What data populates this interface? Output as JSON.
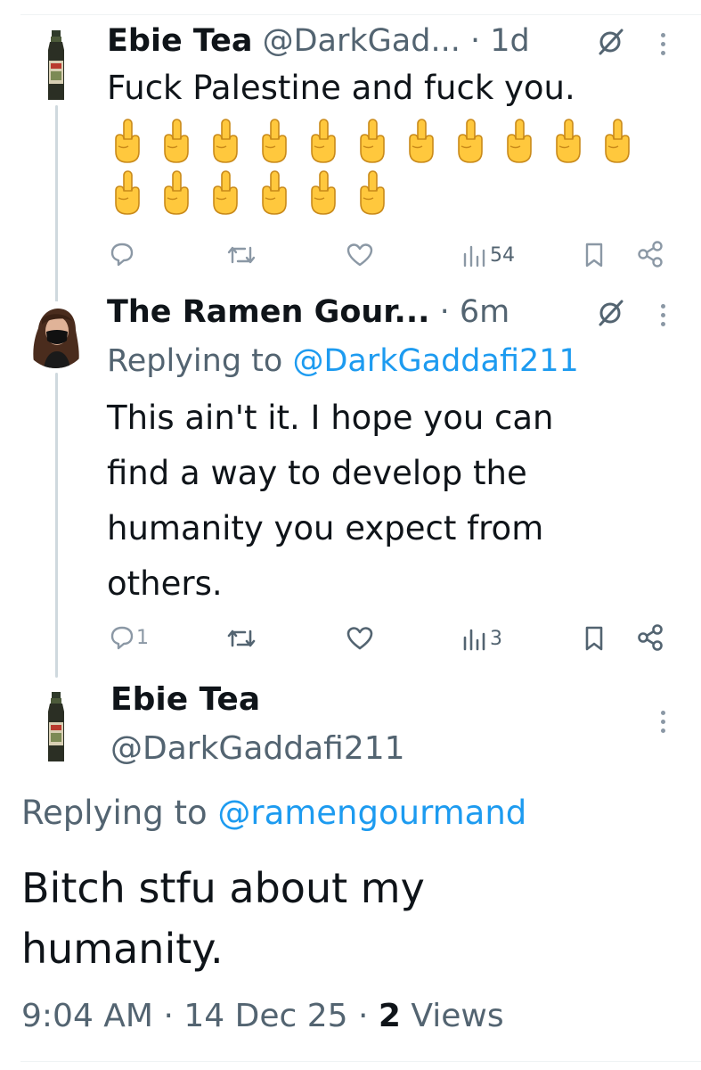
{
  "tweet1": {
    "name": "Ebie Tea",
    "handle": "@DarkGad...",
    "dot": "·",
    "time": "1d",
    "text": "Fuck Palestine and fuck you.",
    "emoji": "🖕",
    "emoji_count": 17,
    "actions": {
      "replies": "",
      "reposts": "",
      "likes": "",
      "views": "54"
    }
  },
  "tweet2": {
    "name": "The Ramen Gour...",
    "dot": "·",
    "time": "6m",
    "replying_prefix": "Replying to ",
    "replying_to": "@DarkGaddafi211",
    "text_lines": [
      "This ain't it. I hope you can",
      "find a way to develop the",
      "humanity you expect from",
      "others."
    ],
    "actions": {
      "replies": "1",
      "reposts": "",
      "likes": "",
      "views": "3"
    }
  },
  "main": {
    "name": "Ebie Tea",
    "handle": "@DarkGaddafi211",
    "replying_prefix": "Replying to ",
    "replying_to": "@ramengourmand",
    "text_lines": [
      "Bitch stfu about my",
      "humanity."
    ],
    "time": "9:04 AM",
    "date": "14 Dec 25",
    "views_count": "2",
    "views_label": "Views"
  },
  "colors": {
    "link": "#1d9bf0",
    "muted": "#536471",
    "text": "#0f1419"
  }
}
